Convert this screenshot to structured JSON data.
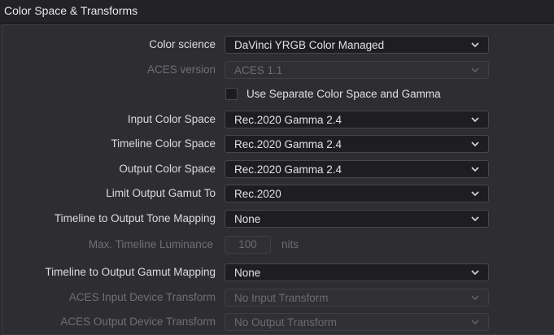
{
  "header": {
    "title": "Color Space & Transforms"
  },
  "rows": {
    "color_science": {
      "label": "Color science",
      "value": "DaVinci YRGB Color Managed"
    },
    "aces_version": {
      "label": "ACES version",
      "value": "ACES 1.1"
    },
    "separate_cs": {
      "label": "Use Separate Color Space and Gamma",
      "checked": false
    },
    "input_cs": {
      "label": "Input Color Space",
      "value": "Rec.2020 Gamma 2.4"
    },
    "timeline_cs": {
      "label": "Timeline Color Space",
      "value": "Rec.2020 Gamma 2.4"
    },
    "output_cs": {
      "label": "Output Color Space",
      "value": "Rec.2020 Gamma 2.4"
    },
    "limit_gamut": {
      "label": "Limit Output Gamut To",
      "value": "Rec.2020"
    },
    "tone_mapping": {
      "label": "Timeline to Output Tone Mapping",
      "value": "None"
    },
    "max_luminance": {
      "label": "Max. Timeline Luminance",
      "value": "100",
      "unit": "nits"
    },
    "gamut_mapping": {
      "label": "Timeline to Output Gamut Mapping",
      "value": "None"
    },
    "aces_input": {
      "label": "ACES Input Device Transform",
      "value": "No Input Transform"
    },
    "aces_output": {
      "label": "ACES Output Device Transform",
      "value": "No Output Transform"
    }
  },
  "icons": {
    "dropdown": "chevron-down-icon"
  }
}
